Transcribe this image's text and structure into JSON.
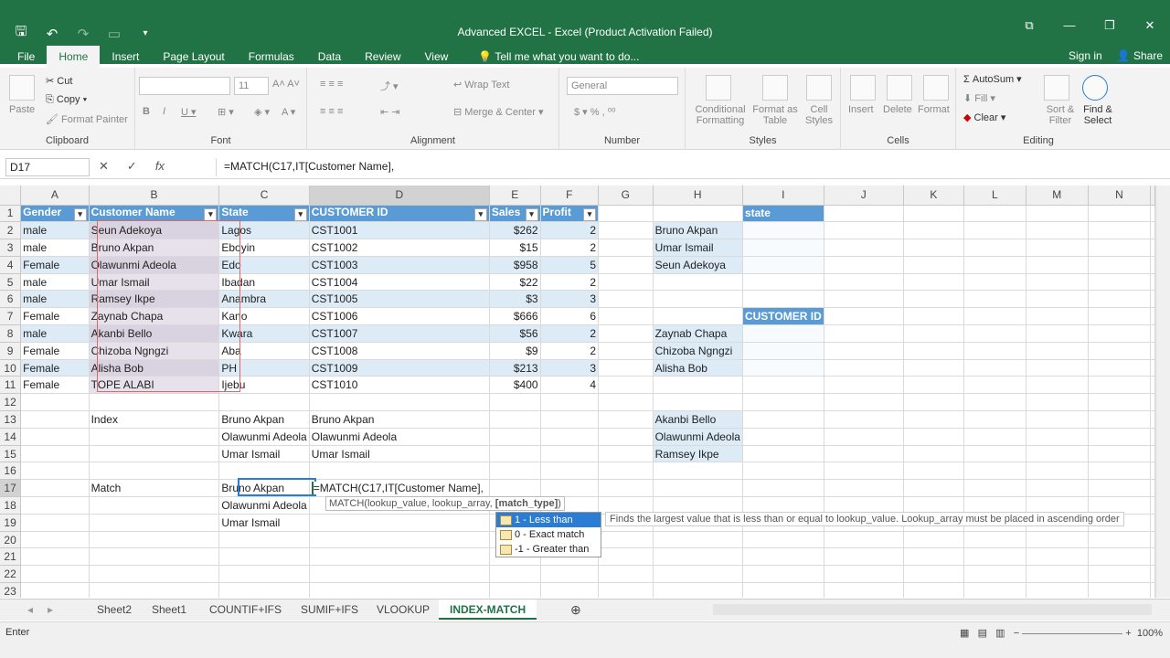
{
  "window": {
    "title": "Advanced EXCEL - Excel (Product Activation Failed)"
  },
  "ribbon_tabs": [
    "File",
    "Home",
    "Insert",
    "Page Layout",
    "Formulas",
    "Data",
    "Review",
    "View"
  ],
  "tell_me": "Tell me what you want to do...",
  "sign_in": "Sign in",
  "share": "Share",
  "ribbon": {
    "clipboard": {
      "paste": "Paste",
      "cut": "Cut",
      "copy": "Copy",
      "format_painter": "Format Painter",
      "label": "Clipboard"
    },
    "font": {
      "size": "11",
      "label": "Font"
    },
    "alignment": {
      "wrap": "Wrap Text",
      "merge": "Merge & Center",
      "label": "Alignment"
    },
    "number": {
      "format": "General",
      "label": "Number"
    },
    "styles": {
      "cond": "Conditional Formatting",
      "table": "Format as Table",
      "cell": "Cell Styles",
      "label": "Styles"
    },
    "cells": {
      "insert": "Insert",
      "delete": "Delete",
      "format": "Format",
      "label": "Cells"
    },
    "editing": {
      "autosum": "AutoSum",
      "fill": "Fill",
      "clear": "Clear",
      "sort": "Sort & Filter",
      "find": "Find & Select",
      "label": "Editing"
    }
  },
  "name_box": "D17",
  "formula_bar": "=MATCH(C17,IT[Customer Name],",
  "columns": [
    "A",
    "B",
    "C",
    "D",
    "E",
    "F",
    "G",
    "H",
    "I",
    "J",
    "K",
    "L",
    "M",
    "N"
  ],
  "rows": [
    {
      "n": "1",
      "c": [
        "Gender",
        "Customer Name",
        "State",
        "CUSTOMER ID",
        "Sales",
        "Profit",
        "",
        "",
        "state",
        "",
        "",
        "",
        "",
        ""
      ]
    },
    {
      "n": "2",
      "c": [
        "male",
        "Seun Adekoya",
        "Lagos",
        "CST1001",
        "$262",
        "2",
        "",
        "Bruno Akpan",
        "",
        "",
        "",
        "",
        "",
        ""
      ]
    },
    {
      "n": "3",
      "c": [
        "male",
        "Bruno Akpan",
        "Eboyin",
        "CST1002",
        "$15",
        "2",
        "",
        "Umar Ismail",
        "",
        "",
        "",
        "",
        "",
        ""
      ]
    },
    {
      "n": "4",
      "c": [
        "Female",
        "Olawunmi Adeola",
        "Edo",
        "CST1003",
        "$958",
        "5",
        "",
        "Seun Adekoya",
        "",
        "",
        "",
        "",
        "",
        ""
      ]
    },
    {
      "n": "5",
      "c": [
        "male",
        "Umar Ismail",
        "Ibadan",
        "CST1004",
        "$22",
        "2",
        "",
        "",
        "",
        "",
        "",
        "",
        "",
        ""
      ]
    },
    {
      "n": "6",
      "c": [
        "male",
        "Ramsey Ikpe",
        "Anambra",
        "CST1005",
        "$3",
        "3",
        "",
        "",
        "",
        "",
        "",
        "",
        "",
        ""
      ]
    },
    {
      "n": "7",
      "c": [
        "Female",
        "Zaynab Chapa",
        "Kano",
        "CST1006",
        "$666",
        "6",
        "",
        "",
        "CUSTOMER ID",
        "",
        "",
        "",
        "",
        ""
      ]
    },
    {
      "n": "8",
      "c": [
        "male",
        "Akanbi Bello",
        "Kwara",
        "CST1007",
        "$56",
        "2",
        "",
        "Zaynab Chapa",
        "",
        "",
        "",
        "",
        "",
        ""
      ]
    },
    {
      "n": "9",
      "c": [
        "Female",
        "Chizoba Ngngzi",
        "Aba",
        "CST1008",
        "$9",
        "2",
        "",
        "Chizoba Ngngzi",
        "",
        "",
        "",
        "",
        "",
        ""
      ]
    },
    {
      "n": "10",
      "c": [
        "Female",
        "Alisha Bob",
        "PH",
        "CST1009",
        "$213",
        "3",
        "",
        "Alisha Bob",
        "",
        "",
        "",
        "",
        "",
        ""
      ]
    },
    {
      "n": "11",
      "c": [
        "Female",
        "TOPE ALABI",
        "Ijebu",
        "CST1010",
        "$400",
        "4",
        "",
        "",
        "",
        "",
        "",
        "",
        "",
        ""
      ]
    },
    {
      "n": "12",
      "c": [
        "",
        "",
        "",
        "",
        "",
        "",
        "",
        "",
        "",
        "",
        "",
        "",
        "",
        ""
      ]
    },
    {
      "n": "13",
      "c": [
        "",
        "Index",
        "Bruno Akpan",
        "Bruno Akpan",
        "",
        "",
        "",
        "Akanbi Bello",
        "",
        "",
        "",
        "",
        "",
        ""
      ]
    },
    {
      "n": "14",
      "c": [
        "",
        "",
        "Olawunmi Adeola",
        "Olawunmi Adeola",
        "",
        "",
        "",
        "Olawunmi Adeola",
        "",
        "",
        "",
        "",
        "",
        ""
      ]
    },
    {
      "n": "15",
      "c": [
        "",
        "",
        "Umar Ismail",
        "Umar Ismail",
        "",
        "",
        "",
        "Ramsey Ikpe",
        "",
        "",
        "",
        "",
        "",
        ""
      ]
    },
    {
      "n": "16",
      "c": [
        "",
        "",
        "",
        "",
        "",
        "",
        "",
        "",
        "",
        "",
        "",
        "",
        "",
        ""
      ]
    },
    {
      "n": "17",
      "c": [
        "",
        "Match",
        "Bruno Akpan",
        "",
        "",
        "",
        "",
        "",
        "",
        "",
        "",
        "",
        "",
        ""
      ]
    },
    {
      "n": "18",
      "c": [
        "",
        "",
        "Olawunmi Adeola",
        "",
        "",
        "",
        "",
        "",
        "",
        "",
        "",
        "",
        "",
        ""
      ]
    },
    {
      "n": "19",
      "c": [
        "",
        "",
        "Umar Ismail",
        "",
        "",
        "",
        "",
        "",
        "",
        "",
        "",
        "",
        "",
        ""
      ]
    },
    {
      "n": "20",
      "c": [
        "",
        "",
        "",
        "",
        "",
        "",
        "",
        "",
        "",
        "",
        "",
        "",
        "",
        ""
      ]
    },
    {
      "n": "21",
      "c": [
        "",
        "",
        "",
        "",
        "",
        "",
        "",
        "",
        "",
        "",
        "",
        "",
        "",
        ""
      ]
    },
    {
      "n": "22",
      "c": [
        "",
        "",
        "",
        "",
        "",
        "",
        "",
        "",
        "",
        "",
        "",
        "",
        "",
        ""
      ]
    },
    {
      "n": "23",
      "c": [
        "",
        "",
        "",
        "",
        "",
        "",
        "",
        "",
        "",
        "",
        "",
        "",
        "",
        ""
      ]
    }
  ],
  "cell_edit": "=MATCH(C17,IT[Customer Name],",
  "tooltip": {
    "fn": "MATCH(lookup_value, lookup_array, ",
    "bold_arg": "[match_type]",
    "close": ")"
  },
  "autocomplete": [
    "1 - Less than",
    "0 - Exact match",
    "-1 - Greater than"
  ],
  "autocomplete_desc": "Finds the largest value that is less than or equal to lookup_value. Lookup_array must be placed in ascending order",
  "sheet_tabs": [
    "Sheet2",
    "Sheet1",
    "COUNTIF+IFS",
    "SUMIF+IFS",
    "VLOOKUP",
    "INDEX-MATCH"
  ],
  "active_sheet": "INDEX-MATCH",
  "status": "Enter",
  "zoom": "100%",
  "colors": {
    "accent": "#217346",
    "header_blue": "#5b9bd5",
    "band": "#ddebf7"
  }
}
